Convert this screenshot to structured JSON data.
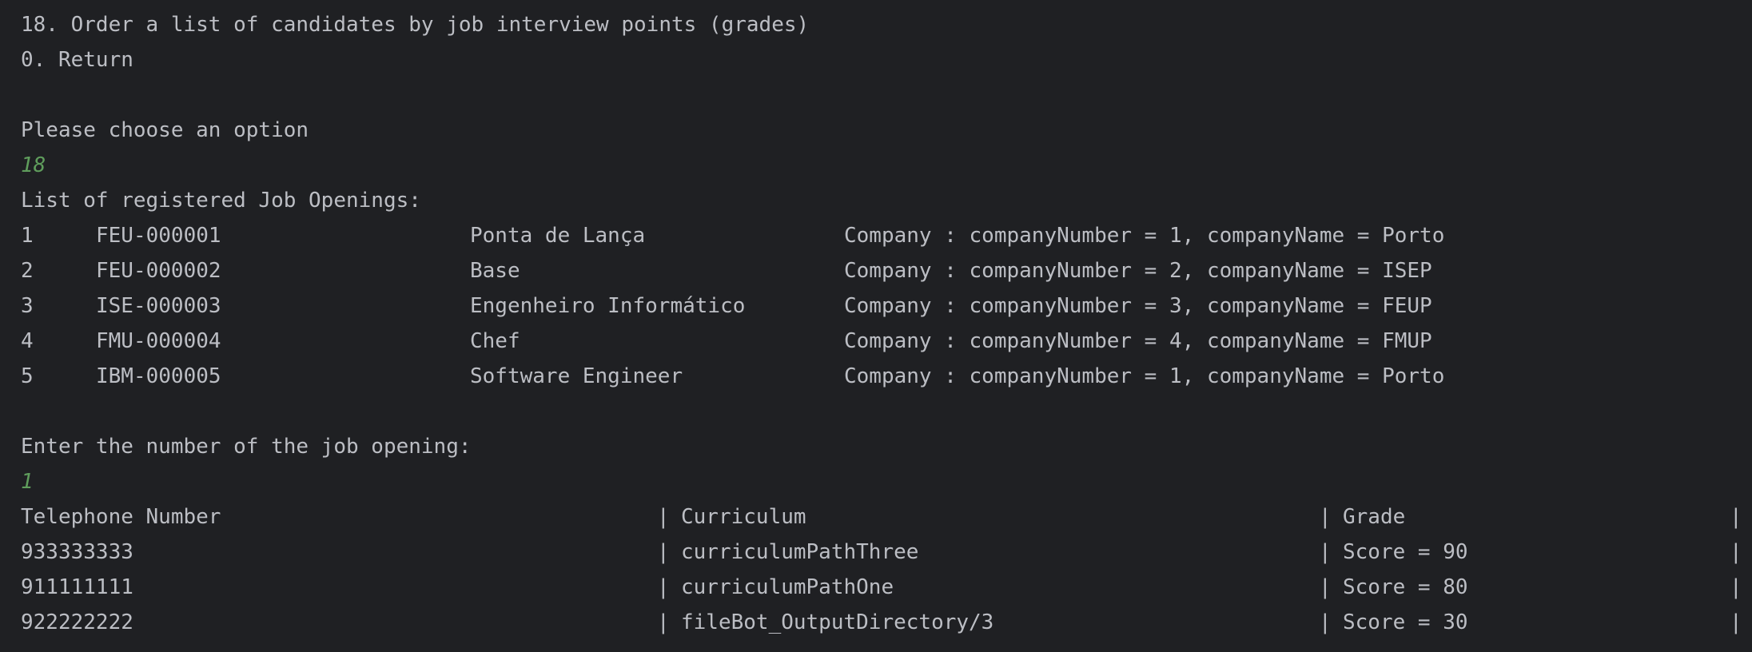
{
  "menu": {
    "option18": "18. Order a list of candidates by job interview points (grades)",
    "option0": "0. Return"
  },
  "prompt_option": "Please choose an option",
  "input_option": "18",
  "job_openings_header": "List of registered Job Openings:",
  "job_openings": [
    {
      "index": "1",
      "reference": "FEU-000001",
      "title": "Ponta de Lança",
      "company": "Company : companyNumber = 1, companyName = Porto"
    },
    {
      "index": "2",
      "reference": "FEU-000002",
      "title": "Base",
      "company": "Company : companyNumber = 2, companyName = ISEP"
    },
    {
      "index": "3",
      "reference": "ISE-000003",
      "title": "Engenheiro Informático",
      "company": "Company : companyNumber = 3, companyName = FEUP"
    },
    {
      "index": "4",
      "reference": "FMU-000004",
      "title": "Chef",
      "company": "Company : companyNumber = 4, companyName = FMUP"
    },
    {
      "index": "5",
      "reference": "IBM-000005",
      "title": "Software Engineer",
      "company": "Company : companyNumber = 1, companyName = Porto"
    }
  ],
  "prompt_job_number": "Enter the number of the job opening:",
  "input_job_number": "1",
  "table": {
    "separator": "|",
    "headers": {
      "phone": "Telephone Number",
      "curriculum": "Curriculum",
      "grade": "Grade"
    },
    "rows": [
      {
        "phone": "933333333",
        "curriculum": "curriculumPathThree",
        "grade": "Score = 90"
      },
      {
        "phone": "911111111",
        "curriculum": "curriculumPathOne",
        "grade": "Score = 80"
      },
      {
        "phone": "922222222",
        "curriculum": "fileBot_OutputDirectory/3",
        "grade": "Score = 30"
      }
    ]
  },
  "colors": {
    "background": "#1f2023",
    "text": "#bcbec4",
    "user_input": "#5f9d5c"
  }
}
